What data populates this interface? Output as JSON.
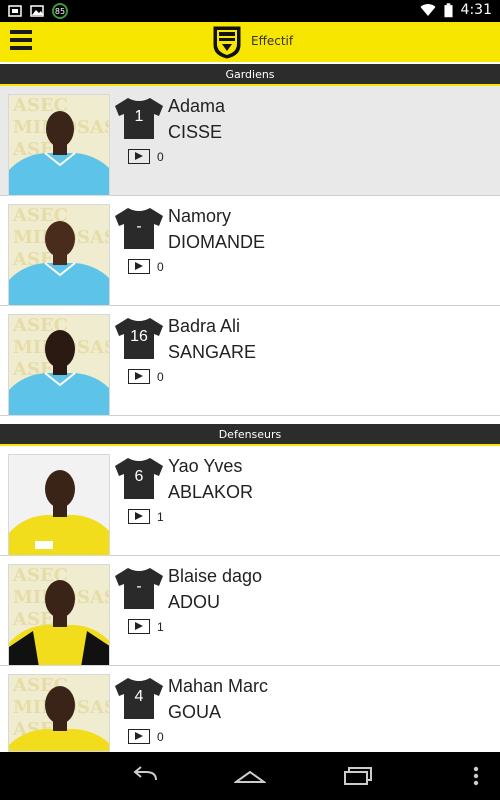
{
  "status_bar": {
    "time": "4:31",
    "badge": "85",
    "icons": [
      "notification-icon",
      "image-icon",
      "badge-icon",
      "wifi-icon",
      "battery-icon"
    ]
  },
  "app_bar": {
    "title": "Effectif",
    "logo_text": "ASEC MIMOSAS",
    "menu_icon": "hamburger-menu-icon"
  },
  "sections": [
    {
      "title": "Gardiens",
      "players": [
        {
          "first_name": "Adama",
          "last_name": "CISSE",
          "number": "1",
          "videos": "0",
          "shirt": "sky"
        },
        {
          "first_name": "Namory",
          "last_name": "DIOMANDE",
          "number": "-",
          "videos": "0",
          "shirt": "sky"
        },
        {
          "first_name": "Badra Ali",
          "last_name": "SANGARE",
          "number": "16",
          "videos": "0",
          "shirt": "sky"
        }
      ]
    },
    {
      "title": "Defenseurs",
      "players": [
        {
          "first_name": "Yao Yves",
          "last_name": "ABLAKOR",
          "number": "6",
          "videos": "1",
          "shirt": "yellow"
        },
        {
          "first_name": "Blaise dago",
          "last_name": "ADOU",
          "number": "-",
          "videos": "1",
          "shirt": "yellow"
        },
        {
          "first_name": "Mahan Marc",
          "last_name": "GOUA",
          "number": "4",
          "videos": "0",
          "shirt": "yellow"
        }
      ]
    }
  ],
  "nav_bar": {
    "buttons": [
      "back-icon",
      "home-icon",
      "recent-apps-icon",
      "overflow-menu-icon"
    ]
  },
  "colors": {
    "brand_yellow": "#f7e600",
    "header_dark": "#2c2c2c",
    "jersey": "#2a2a2a",
    "shirt_sky": "#5ec3e8",
    "shirt_yellow": "#f2dd1c"
  }
}
